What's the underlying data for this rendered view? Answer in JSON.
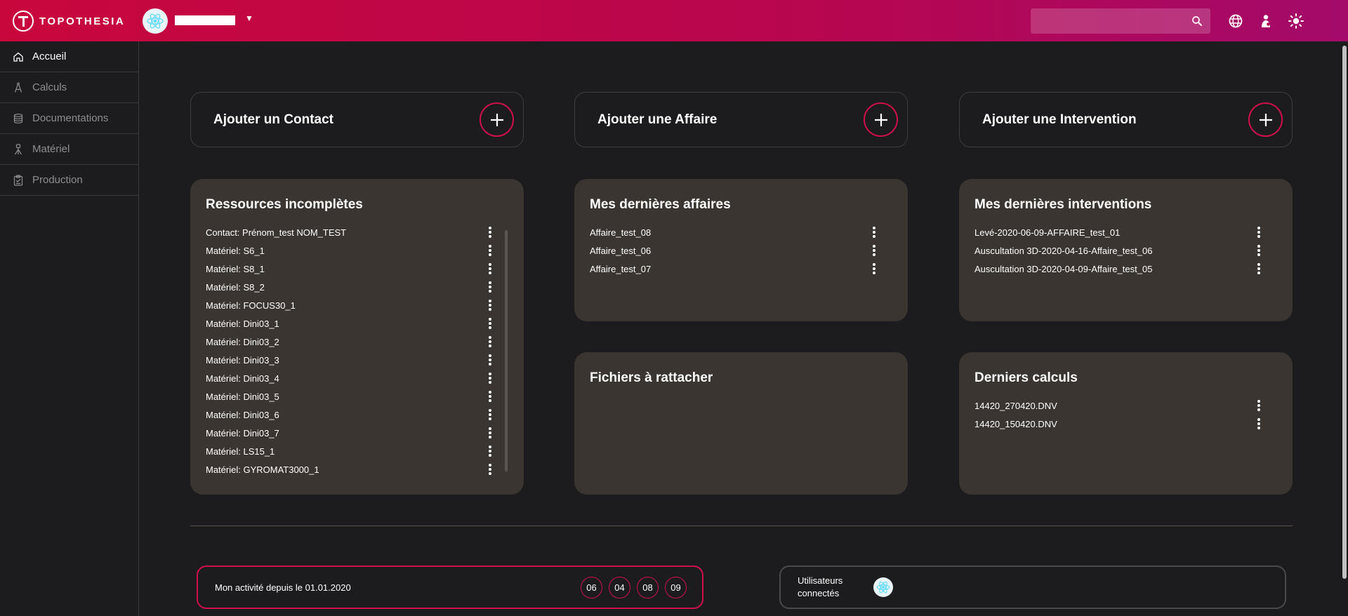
{
  "app": {
    "logo_text": "TOPOTHESIA"
  },
  "header": {
    "search_placeholder": "",
    "icons": [
      "search-icon",
      "globe-icon",
      "user-icon",
      "theme-sun-icon"
    ],
    "accent_colors": [
      "#c8073d",
      "#a40a6a"
    ]
  },
  "sidebar": {
    "items": [
      {
        "label": "Accueil",
        "icon": "home-icon"
      },
      {
        "label": "Calculs",
        "icon": "compass-icon"
      },
      {
        "label": "Documentations",
        "icon": "stack-icon"
      },
      {
        "label": "Matériel",
        "icon": "tripod-icon"
      },
      {
        "label": "Production",
        "icon": "clipboard-icon"
      }
    ]
  },
  "actions": [
    {
      "label": "Ajouter un Contact"
    },
    {
      "label": "Ajouter une Affaire"
    },
    {
      "label": "Ajouter une Intervention"
    }
  ],
  "panels": {
    "incomplete": {
      "title": "Ressources incomplètes",
      "items": [
        "Contact: Prénom_test NOM_TEST",
        "Matériel: S6_1",
        "Matériel: S8_1",
        "Matériel: S8_2",
        "Matériel: FOCUS30_1",
        "Matériel: Dini03_1",
        "Matériel: Dini03_2",
        "Matériel: Dini03_3",
        "Matériel: Dini03_4",
        "Matériel: Dini03_5",
        "Matériel: Dini03_6",
        "Matériel: Dini03_7",
        "Matériel: LS15_1",
        "Matériel: GYROMAT3000_1"
      ]
    },
    "affaires": {
      "title": "Mes dernières affaires",
      "items": [
        "Affaire_test_08",
        "Affaire_test_06",
        "Affaire_test_07"
      ]
    },
    "interventions": {
      "title": "Mes dernières interventions",
      "items": [
        "Levé-2020-06-09-AFFAIRE_test_01",
        "Auscultation 3D-2020-04-16-Affaire_test_06",
        "Auscultation 3D-2020-04-09-Affaire_test_05"
      ]
    },
    "files": {
      "title": "Fichiers à rattacher"
    },
    "calculs": {
      "title": "Derniers calculs",
      "items": [
        "14420_270420.DNV",
        "14420_150420.DNV"
      ]
    }
  },
  "activity": {
    "label": "Mon activité depuis le 01.01.2020",
    "counters": [
      "06",
      "04",
      "08",
      "09"
    ]
  },
  "users": {
    "label": "Utilisateurs connectés"
  }
}
